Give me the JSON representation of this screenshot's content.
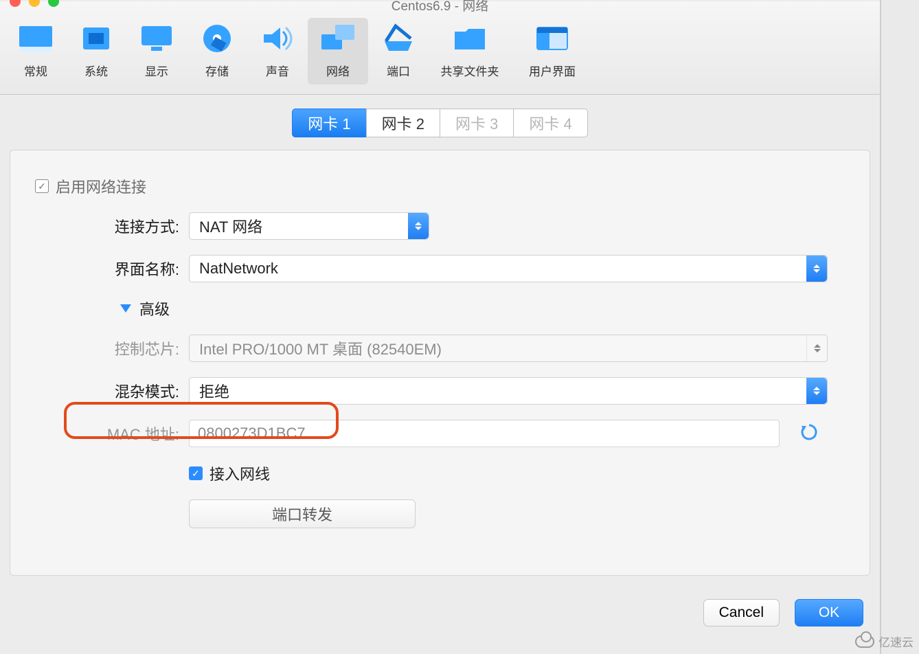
{
  "window": {
    "title": "Centos6.9 - 网络"
  },
  "traffic": {
    "close": "#ff5f57",
    "min": "#febc2e",
    "max": "#28c840"
  },
  "toolbar": {
    "items": [
      {
        "label": "常规"
      },
      {
        "label": "系统"
      },
      {
        "label": "显示"
      },
      {
        "label": "存储"
      },
      {
        "label": "声音"
      },
      {
        "label": "网络"
      },
      {
        "label": "端口"
      },
      {
        "label": "共享文件夹"
      },
      {
        "label": "用户界面"
      }
    ]
  },
  "subtabs": {
    "items": [
      "网卡 1",
      "网卡 2",
      "网卡 3",
      "网卡 4"
    ]
  },
  "panel": {
    "enable_label": "启用网络连接",
    "attach_label": "连接方式:",
    "attach_value": "NAT 网络",
    "ifname_label": "界面名称:",
    "ifname_value": "NatNetwork",
    "advanced_label": "高级",
    "adapter_label": "控制芯片:",
    "adapter_value": "Intel PRO/1000 MT 桌面 (82540EM)",
    "promisc_label": "混杂模式:",
    "promisc_value": "拒绝",
    "mac_label": "MAC 地址:",
    "mac_value": "0800273D1BC7",
    "cable_label": "接入网线",
    "portfwd_label": "端口转发"
  },
  "footer": {
    "cancel": "Cancel",
    "ok": "OK"
  },
  "watermark": "亿速云"
}
